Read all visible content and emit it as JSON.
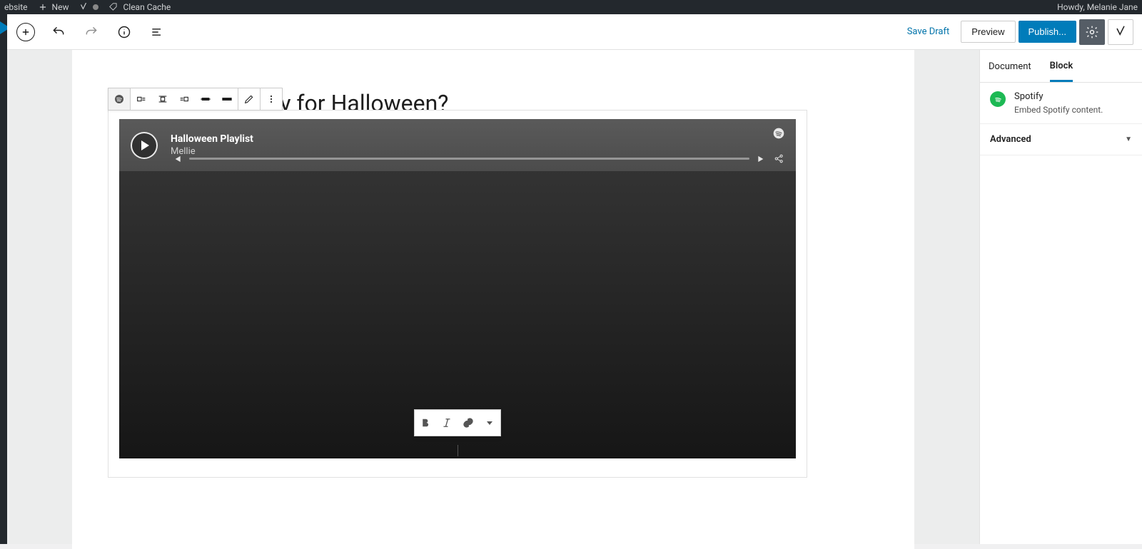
{
  "adminbar": {
    "website_label": "ebsite",
    "new_label": "New",
    "clean_cache_label": "Clean Cache",
    "howdy_label": "Howdy, Melanie Jane"
  },
  "editor_header": {
    "save_draft_label": "Save Draft",
    "preview_label": "Preview",
    "publish_label": "Publish..."
  },
  "post": {
    "title": "Are Your Ready for Halloween?"
  },
  "spotify_embed": {
    "playlist_title": "Halloween Playlist",
    "artist": "Mellie"
  },
  "sidebar": {
    "tab_document": "Document",
    "tab_block": "Block",
    "block_name": "Spotify",
    "block_description": "Embed Spotify content.",
    "panel_advanced": "Advanced"
  }
}
